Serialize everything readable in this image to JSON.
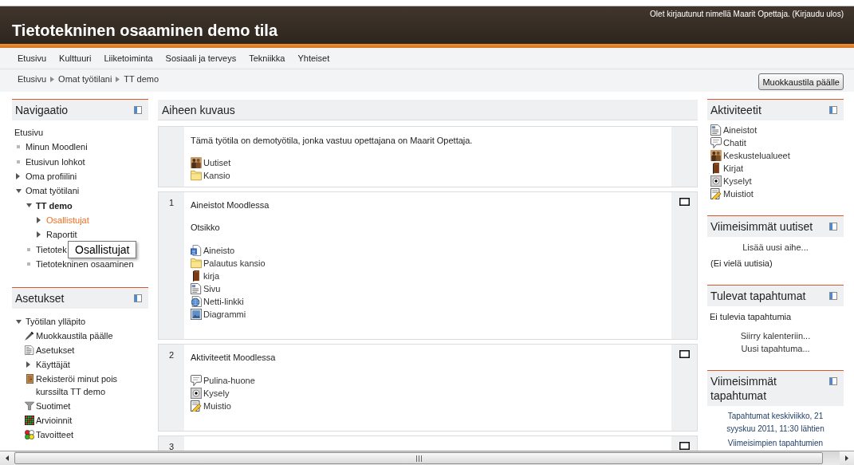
{
  "header": {
    "login": {
      "text": "Olet kirjautunut nimellä",
      "user": "Maarit Opettaja",
      "middle": ". (",
      "logout": "Kirjaudu ulos",
      "end": ")"
    },
    "title": "Tietotekninen osaaminen demo tila"
  },
  "menu": [
    "Etusivu",
    "Kulttuuri",
    "Liiketoiminta",
    "Sosiaali ja terveys",
    "Tekniikka",
    "Yhteiset"
  ],
  "breadcrumb": [
    "Etusivu",
    "Omat työtilani",
    "TT demo"
  ],
  "edit_button": "Muokkaustila päälle",
  "navigation": {
    "title": "Navigaatio",
    "items": [
      {
        "label": "Etusivu",
        "kind": "root",
        "highlighted": false,
        "children": [
          {
            "label": "Minun Moodleni",
            "kind": "leaf",
            "highlighted": false
          },
          {
            "label": "Etusivun lohkot",
            "kind": "leaf",
            "highlighted": false
          },
          {
            "label": "Oma profiilini",
            "kind": "branch",
            "expanded": false,
            "highlighted": false
          },
          {
            "label": "Omat työtilani",
            "kind": "branch",
            "expanded": true,
            "highlighted": false,
            "children": [
              {
                "label": "TT demo",
                "kind": "course",
                "expanded": true,
                "highlighted": false,
                "children": [
                  {
                    "label": "Osallistujat",
                    "kind": "branch",
                    "expanded": false,
                    "highlighted": true
                  },
                  {
                    "label": "Raportit",
                    "kind": "branch",
                    "expanded": false,
                    "highlighted": false
                  }
                ]
              },
              {
                "label": "Tietotek",
                "kind": "leaf",
                "highlighted": false
              },
              {
                "label": "Tietotekninen osaaminen",
                "kind": "leaf",
                "highlighted": false
              }
            ]
          }
        ]
      }
    ],
    "tooltip": "Osallistujat"
  },
  "settings": {
    "title": "Asetukset",
    "items": [
      {
        "label": "Työtilan ylläpito",
        "kind": "branch",
        "expanded": true,
        "children": [
          {
            "label": "Muokkaustila päälle",
            "kind": "edit"
          },
          {
            "label": "Asetukset",
            "kind": "settings"
          },
          {
            "label": "Käyttäjät",
            "kind": "branch",
            "expanded": false
          },
          {
            "label": "Rekisteröi minut pois kurssilta TT demo",
            "kind": "unenrol"
          },
          {
            "label": "Suotimet",
            "kind": "filter"
          },
          {
            "label": "Arvioinnit",
            "kind": "grades"
          },
          {
            "label": "Tavoitteet",
            "kind": "outcomes"
          }
        ]
      }
    ]
  },
  "content": {
    "heading": "Aiheen kuvaus",
    "sections": [
      {
        "kind": "intro",
        "highlighted": false,
        "summary": "Tämä työtila on demotyötila, jonka vastuu opettajana on Maarit Opettaja.",
        "activities": [
          {
            "label": "Uutiset",
            "kind": "forum"
          },
          {
            "label": "Kansio",
            "kind": "folder"
          }
        ]
      },
      {
        "kind": "topic",
        "number": "1",
        "highlighted": false,
        "title": "Aineistot Moodlessa",
        "subtitle": "Otsikko",
        "activities": [
          {
            "label": "Aineisto",
            "kind": "file"
          },
          {
            "label": "Palautus kansio",
            "kind": "folder"
          },
          {
            "label": "kirja",
            "kind": "book"
          },
          {
            "label": "Sivu",
            "kind": "page"
          },
          {
            "label": "Netti-linkki",
            "kind": "url"
          },
          {
            "label": "Diagrammi",
            "kind": "image"
          }
        ]
      },
      {
        "kind": "topic",
        "number": "2",
        "highlighted": false,
        "title": "Aktiviteetit Moodlessa",
        "activities": [
          {
            "label": "Pulina-huone",
            "kind": "chat"
          },
          {
            "label": "Kysely",
            "kind": "choice"
          },
          {
            "label": "Muistio",
            "kind": "journal"
          }
        ]
      },
      {
        "kind": "topic",
        "number": "3",
        "highlighted": false
      }
    ]
  },
  "activities": {
    "title": "Aktiviteetit",
    "items": [
      {
        "label": "Aineistot",
        "kind": "resource"
      },
      {
        "label": "Chatit",
        "kind": "chat"
      },
      {
        "label": "Keskustelualueet",
        "kind": "forum"
      },
      {
        "label": "Kirjat",
        "kind": "book"
      },
      {
        "label": "Kyselyt",
        "kind": "choice"
      },
      {
        "label": "Muistiot",
        "kind": "journal"
      }
    ]
  },
  "news": {
    "title": "Viimeisimmät uutiset",
    "add_link": "Lisää uusi aihe...",
    "empty": "(Ei vielä uutisia)"
  },
  "upcoming": {
    "title": "Tulevat tapahtumat",
    "empty": "Ei tulevia tapahtumia",
    "links": [
      "Siirry kalenteriin...",
      "Uusi tapahtuma..."
    ]
  },
  "recent": {
    "title": "Viimeisimmät tapahtumat",
    "since": "Tapahtumat keskiviikko, 21 syyskuu 2011, 11:30 lähtien",
    "link": "Viimeisimpien tapahtumien"
  }
}
